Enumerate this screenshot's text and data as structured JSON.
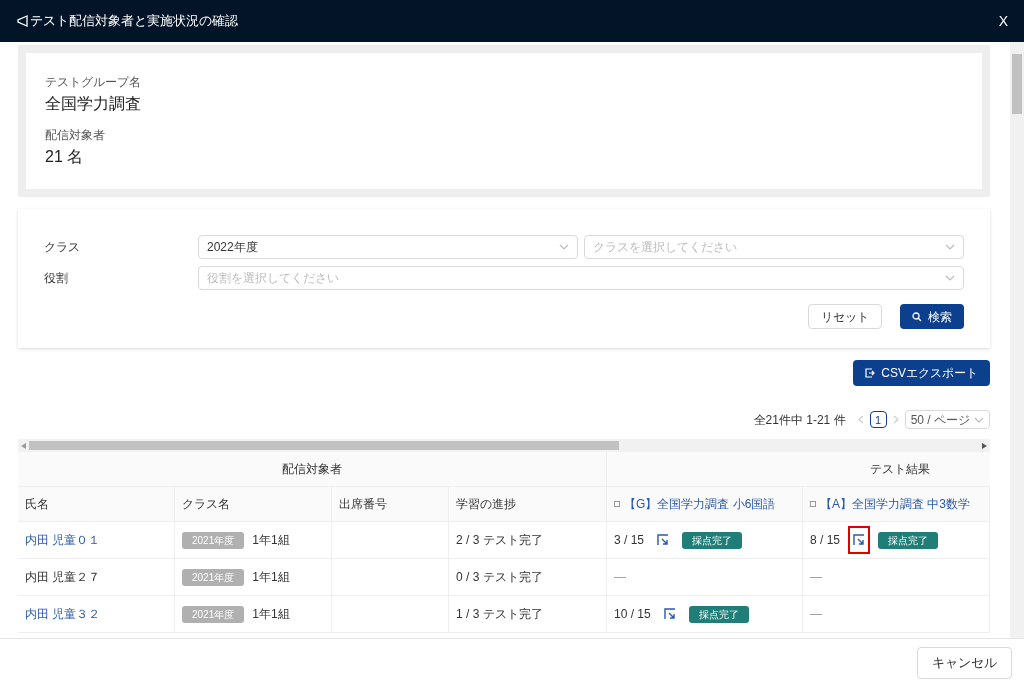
{
  "window": {
    "title": "テスト配信対象者と実施状況の確認",
    "close": "X"
  },
  "summary": {
    "group_label": "テストグループ名",
    "group_value": "全国学力調査",
    "target_label": "配信対象者",
    "target_value": "21 名"
  },
  "filters": [
    {
      "label": "クラス",
      "selects": [
        {
          "value": "2022年度"
        },
        {
          "placeholder": "クラスを選択してください"
        }
      ]
    },
    {
      "label": "役割",
      "selects": [
        {
          "placeholder": "役割を選択してください"
        }
      ]
    }
  ],
  "buttons": {
    "reset": "リセット",
    "search": "検索",
    "csv": "CSVエクスポート",
    "cancel": "キャンセル"
  },
  "pagination": {
    "total": "全21件中 1-21 件",
    "pages": [
      {
        "label": "1",
        "selected": true
      }
    ],
    "page_size": "50 / ページ"
  },
  "table": {
    "groups": [
      "配信対象者",
      "テスト結果"
    ],
    "columns": [
      "氏名",
      "クラス名",
      "出席番号",
      "学習の進捗"
    ],
    "tests": [
      "【G】全国学力調査 小6国語",
      "【A】全国学力調査 中3数学"
    ],
    "rows": [
      {
        "name": "内田 児童０１",
        "link": true,
        "year": "2021年度",
        "class": "1年1組",
        "progress": "2 / 3 テスト完了",
        "results": [
          {
            "score": "3 / 15",
            "status": "採点完了",
            "highlighted": false
          },
          {
            "score": "8 / 15",
            "status": "採点完了",
            "highlighted": true
          }
        ]
      },
      {
        "name": "内田 児童２７",
        "link": false,
        "year": "2021年度",
        "class": "1年1組",
        "progress": "0 / 3 テスト完了",
        "results": [
          {
            "dash": "—"
          },
          {
            "dash": "—"
          }
        ]
      },
      {
        "name": "内田 児童３２",
        "link": true,
        "year": "2021年度",
        "class": "1年1組",
        "progress": "1 / 3 テスト完了",
        "results": [
          {
            "score": "10 / 15",
            "status": "採点完了",
            "highlighted": false
          },
          {
            "dash": "—"
          }
        ]
      }
    ]
  }
}
